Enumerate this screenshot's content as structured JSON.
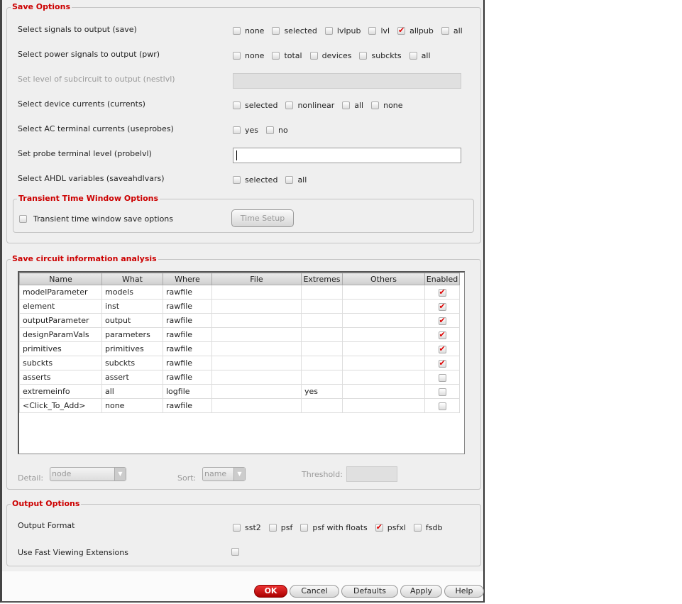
{
  "save_options": {
    "title": "Save Options",
    "rows": [
      {
        "label": "Select signals to output (save)",
        "options": [
          {
            "label": "none",
            "checked": false
          },
          {
            "label": "selected",
            "checked": false
          },
          {
            "label": "lvlpub",
            "checked": false
          },
          {
            "label": "lvl",
            "checked": false
          },
          {
            "label": "allpub",
            "checked": true
          },
          {
            "label": "all",
            "checked": false
          }
        ]
      },
      {
        "label": "Select power signals to output (pwr)",
        "options": [
          {
            "label": "none",
            "checked": false
          },
          {
            "label": "total",
            "checked": false
          },
          {
            "label": "devices",
            "checked": false
          },
          {
            "label": "subckts",
            "checked": false
          },
          {
            "label": "all",
            "checked": false
          }
        ]
      },
      {
        "label": "Set level of subcircuit to output (nestlvl)"
      },
      {
        "label": "Select device currents (currents)",
        "options": [
          {
            "label": "selected",
            "checked": false
          },
          {
            "label": "nonlinear",
            "checked": false
          },
          {
            "label": "all",
            "checked": false
          },
          {
            "label": "none",
            "checked": false
          }
        ]
      },
      {
        "label": "Select AC terminal currents (useprobes)",
        "options": [
          {
            "label": "yes",
            "checked": false
          },
          {
            "label": "no",
            "checked": false
          }
        ]
      },
      {
        "label": "Set probe terminal level (probelvl)",
        "value": ""
      },
      {
        "label": "Select AHDL variables (saveahdlvars)",
        "options": [
          {
            "label": "selected",
            "checked": false
          },
          {
            "label": "all",
            "checked": false
          }
        ]
      }
    ],
    "transient": {
      "title": "Transient Time Window Options",
      "checkbox_label": "Transient time window save options",
      "checked": false,
      "button": "Time Setup"
    }
  },
  "analysis": {
    "title": "Save circuit information analysis",
    "columns": [
      "Name",
      "What",
      "Where",
      "File",
      "Extremes",
      "Others",
      "Enabled"
    ],
    "rows": [
      [
        "modelParameter",
        "models",
        "rawfile",
        "",
        "",
        "",
        true
      ],
      [
        "element",
        "inst",
        "rawfile",
        "",
        "",
        "",
        true
      ],
      [
        "outputParameter",
        "output",
        "rawfile",
        "",
        "",
        "",
        true
      ],
      [
        "designParamVals",
        "parameters",
        "rawfile",
        "",
        "",
        "",
        true
      ],
      [
        "primitives",
        "primitives",
        "rawfile",
        "",
        "",
        "",
        true
      ],
      [
        "subckts",
        "subckts",
        "rawfile",
        "",
        "",
        "",
        true
      ],
      [
        "asserts",
        "assert",
        "rawfile",
        "",
        "",
        "",
        false
      ],
      [
        "extremeinfo",
        "all",
        "logfile",
        "",
        "yes",
        "",
        false
      ],
      [
        "<Click_To_Add>",
        "none",
        "rawfile",
        "",
        "",
        "",
        false
      ]
    ],
    "detail_label": "Detail:",
    "detail_value": "node",
    "sort_label": "Sort:",
    "sort_value": "name",
    "threshold_label": "Threshold:",
    "threshold_value": ""
  },
  "output_options": {
    "title": "Output Options",
    "format_label": "Output Format",
    "formats": [
      {
        "label": "sst2",
        "checked": false
      },
      {
        "label": "psf",
        "checked": false
      },
      {
        "label": "psf with floats",
        "checked": false
      },
      {
        "label": "psfxl",
        "checked": true
      },
      {
        "label": "fsdb",
        "checked": false
      }
    ],
    "fast_label": "Use Fast Viewing Extensions",
    "fast_checked": false
  },
  "buttons": {
    "ok": "OK",
    "cancel": "Cancel",
    "defaults": "Defaults",
    "apply": "Apply",
    "help": "Help"
  }
}
